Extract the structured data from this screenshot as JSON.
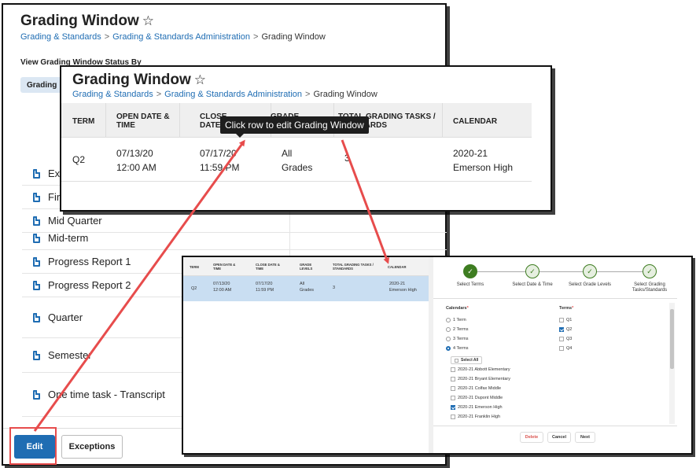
{
  "main_panel": {
    "title": "Grading Window",
    "breadcrumb": [
      "Grading & Standards",
      "Grading & Standards Administration",
      "Grading Window"
    ],
    "section_label": "View Grading Window Status By",
    "filter_chip": "Grading",
    "tasks": [
      "Exam",
      "Final",
      "Mid Quarter",
      "Mid-term",
      "Progress Report 1",
      "Progress Report 2",
      "Quarter",
      "Semester",
      "One time task - Transcript"
    ],
    "edit_label": "Edit",
    "exceptions_label": "Exceptions"
  },
  "zoom_panel": {
    "title": "Grading Window",
    "breadcrumb": [
      "Grading & Standards",
      "Grading & Standards Administration",
      "Grading Window"
    ],
    "headers": [
      "TERM",
      "OPEN DATE & TIME",
      "CLOSE DATE & TIME",
      "GRADE LEVELS",
      "TOTAL GRADING TASKS / STANDARDS",
      "CALENDAR"
    ],
    "row": {
      "term": "Q2",
      "open_date": "07/13/20",
      "open_time": "12:00 AM",
      "close_date": "07/17/20",
      "close_time": "11:59 PM",
      "grade_1": "All",
      "grade_2": "Grades",
      "total": "3",
      "calendar_1": "2020-21",
      "calendar_2": "Emerson High"
    },
    "tooltip": "Click row to edit Grading Window"
  },
  "detail_panel": {
    "headers": [
      "TERM",
      "OPEN DATE & TIME",
      "CLOSE DATE & TIME",
      "GRADE LEVELS",
      "TOTAL GRADING TASKS / STANDARDS",
      "CALENDAR"
    ],
    "row": {
      "term": "Q2",
      "open_date": "07/13/20",
      "open_time": "12:00 AM",
      "close_date": "07/17/20",
      "close_time": "11:59 PM",
      "grade_1": "All",
      "grade_2": "Grades",
      "total": "3",
      "calendar_1": "2020-21",
      "calendar_2": "Emerson High"
    },
    "wizard_steps": [
      "Select Terms",
      "Select Date & Time",
      "Select Grade Levels",
      "Select Grading Tasks/Standards"
    ],
    "calendars_label": "Calendars",
    "terms_label": "Terms",
    "term_options": [
      "1 Term",
      "2 Terms",
      "3 Terms",
      "4 Terms"
    ],
    "select_all": "Select All",
    "calendar_list": [
      "2020-21 Abbott Elementary",
      "2020-21 Bryant Elementary",
      "2020-21 Colfax Middle",
      "2020-21 Dupont Middle",
      "2020-21 Emerson High",
      "2020-21 Franklin High"
    ],
    "term_checks": [
      "Q1",
      "Q2",
      "Q3",
      "Q4"
    ],
    "delete_label": "Delete",
    "cancel_label": "Cancel",
    "next_label": "Next"
  },
  "colors": {
    "accent": "#1f6db3",
    "highlight": "#e74c4c",
    "step_done": "#3e7d21"
  }
}
